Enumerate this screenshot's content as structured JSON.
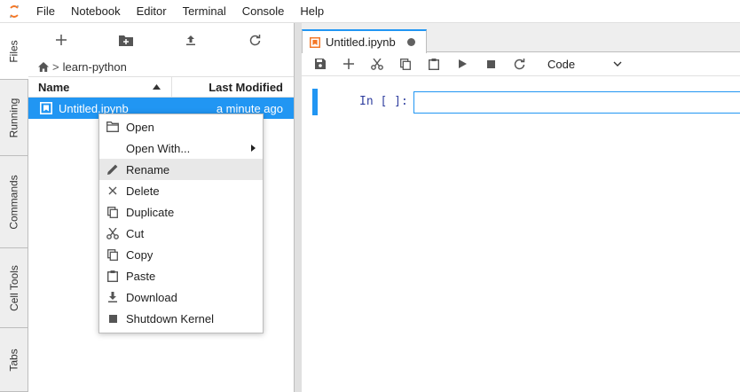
{
  "menubar": {
    "items": [
      "File",
      "Notebook",
      "Editor",
      "Terminal",
      "Console",
      "Help"
    ]
  },
  "sidetabs": [
    "Files",
    "Running",
    "Commands",
    "Cell Tools",
    "Tabs"
  ],
  "filebrowser": {
    "breadcrumb": {
      "folder": "learn-python",
      "separator": ">"
    },
    "columns": {
      "name": "Name",
      "modified": "Last Modified"
    },
    "files": [
      {
        "name": "Untitled.ipynb",
        "modified": "a minute ago",
        "icon": "notebook-icon",
        "selected": true
      }
    ]
  },
  "notebook": {
    "tab_label": "Untitled.ipynb",
    "cell_type": "Code",
    "prompt": "In [ ]:"
  },
  "context_menu": {
    "items": [
      {
        "label": "Open",
        "icon": "folder-icon"
      },
      {
        "label": "Open With...",
        "icon": "",
        "submenu": true
      },
      {
        "label": "Rename",
        "icon": "pencil-icon",
        "hover": true
      },
      {
        "label": "Delete",
        "icon": "close-icon"
      },
      {
        "label": "Duplicate",
        "icon": "copy-icon"
      },
      {
        "label": "Cut",
        "icon": "scissors-icon"
      },
      {
        "label": "Copy",
        "icon": "copy-icon"
      },
      {
        "label": "Paste",
        "icon": "clipboard-icon"
      },
      {
        "label": "Download",
        "icon": "download-icon"
      },
      {
        "label": "Shutdown Kernel",
        "icon": "stop-icon"
      }
    ]
  },
  "colors": {
    "accent": "#2196f3",
    "logo": "#f37726"
  }
}
